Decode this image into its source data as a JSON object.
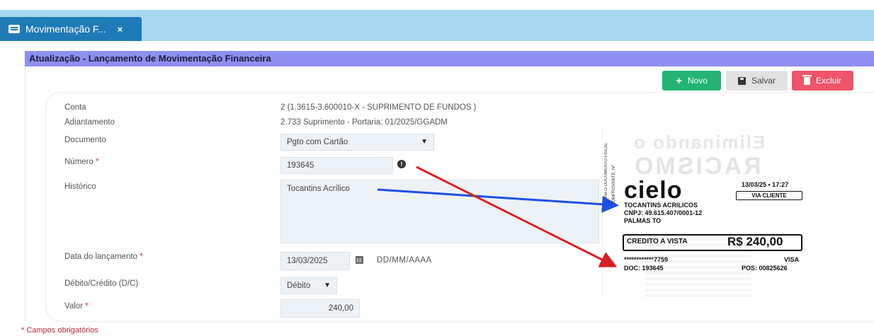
{
  "tab": {
    "label": "Movimentação F...",
    "close": "×"
  },
  "panel": {
    "title": "Atualização - Lançamento de Movimentação Financeira"
  },
  "toolbar": {
    "novo": "Novo",
    "novo_icon": "+",
    "salvar": "Salvar",
    "excluir": "Excluir"
  },
  "form": {
    "conta_label": "Conta",
    "conta_value": "2 (1.3615-3.600010-X - SUPRIMENTO DE FUNDOS )",
    "adiantamento_label": "Adiantamento",
    "adiantamento_value": "2.733 Suprimento - Portaria: 01/2025/GGADM",
    "documento_label": "Documento",
    "documento_value": "Pgto com Cartão",
    "numero_label": "Número",
    "numero_value": "193645",
    "historico_label": "Histórico",
    "historico_value": "Tocantins Acrílico",
    "data_label": "Data do lançamento",
    "data_value": "13/03/2025",
    "data_hint": "DD/MM/AAAA",
    "dc_label": "Débito/Crédito (D/C)",
    "dc_value": "Débito",
    "valor_label": "Valor",
    "valor_value": "240,00",
    "required_mark": "*",
    "footer_note": "* Campos obrigatórios"
  },
  "receipt": {
    "watermark_top": "Eliminando o",
    "watermark_mid": "RACISMO",
    "vertical_1": "FALHA O DOCUMENTO FISCAL",
    "vertical_2": "COMPROVANTE: Nº",
    "brand": "cielo",
    "datetime": "13/03/25 • 17:27",
    "via": "VIA CLIENTE",
    "merchant": "TOCANTINS ACRILICOS",
    "cnpj": "CNPJ: 49.615.407/0001-12",
    "city": "PALMAS TO",
    "payment_type": "CREDITO A VISTA",
    "amount": "R$ 240,00",
    "card": "************7759",
    "brand_card": "VISA",
    "doc": "DOC: 193645",
    "pos": "POS: 00825626"
  },
  "colors": {
    "topbar": "#a9d8ee",
    "tab": "#1f7bb8",
    "panel_header": "#8e8ff0",
    "novo": "#22b573",
    "excluir": "#f0546b",
    "arrow_blue": "#1f4fe0",
    "arrow_red": "#d91f1f"
  }
}
